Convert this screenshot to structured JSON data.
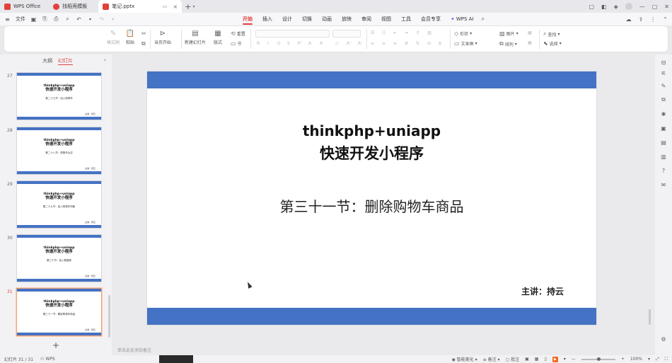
{
  "titlebar": {
    "tabs": [
      {
        "label": "WPS Office",
        "color": "#e0413b"
      },
      {
        "label": "找稻壳模板",
        "color": "#e0413b"
      },
      {
        "label": "笔记.pptx",
        "color": "#e0413b"
      }
    ]
  },
  "menubar": {
    "file_label": "文件",
    "tabs": [
      "开始",
      "插入",
      "设计",
      "切换",
      "动画",
      "放映",
      "审阅",
      "视图",
      "工具",
      "会员专享"
    ],
    "ai_label": "WPS AI"
  },
  "ribbon": {
    "format_painter": "格式刷",
    "paste": "粘贴",
    "play_from_current": "当页开始",
    "new_slide": "新建幻灯片",
    "layout": "版式",
    "reset": "重置",
    "section": "节",
    "shape": "形状",
    "picture": "图片",
    "find": "查找",
    "textbox": "文本框",
    "arrange": "排列",
    "select": "选择"
  },
  "left_panel": {
    "tab_outline": "大纲",
    "tab_slides": "幻灯片",
    "thumbnails": [
      {
        "num": "27",
        "title1": "thinkphp+uniapp",
        "title2": "快速开发小程序",
        "sub": "第二十七节：加入购物车",
        "author": "主讲：持云"
      },
      {
        "num": "28",
        "title1": "thinkphp+uniapp",
        "title2": "快速开发小程序",
        "sub": "第二十八节：购物车为空",
        "author": "主讲：持云"
      },
      {
        "num": "29",
        "title1": "thinkphp+uniapp",
        "title2": "快速开发小程序",
        "sub": "第二十九节：加入购物车判断",
        "author": "主讲：持云"
      },
      {
        "num": "30",
        "title1": "thinkphp+uniapp",
        "title2": "快速开发小程序",
        "sub": "第三十节：加入数据库",
        "author": "主讲：持云"
      },
      {
        "num": "31",
        "title1": "thinkphp+uniapp",
        "title2": "快速开发小程序",
        "sub": "第三十一节：删除购物车商品",
        "author": "主讲：持云"
      }
    ]
  },
  "slide": {
    "title1": "thinkphp+uniapp",
    "title2": "快速开发小程序",
    "subtitle": "第三十一节：删除购物车商品",
    "author": "主讲：持云",
    "accent_color": "#4472c4"
  },
  "notes_placeholder": "单击此处添加备注",
  "statusbar": {
    "slide_count": "幻灯片 31 / 31",
    "wps_label": "WPS",
    "smart_beautify": "智能美化",
    "notes": "备注",
    "comments": "批注",
    "zoom": "100%"
  }
}
